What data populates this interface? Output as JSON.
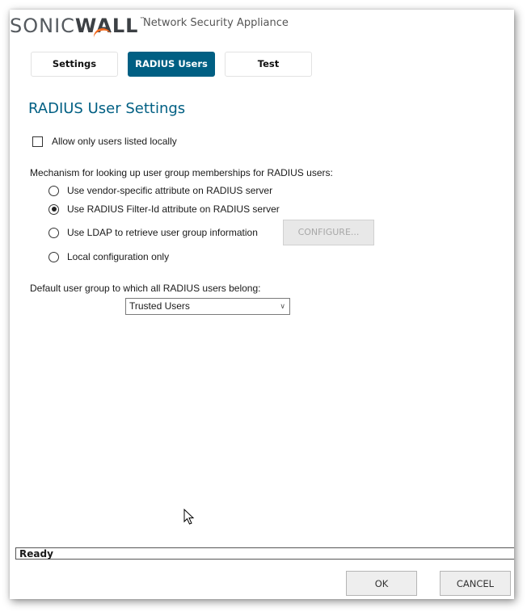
{
  "header": {
    "logo_sonic": "SONIC",
    "logo_wall": "WALL",
    "logo_tm": "™",
    "subtitle": "Network Security Appliance"
  },
  "tabs": [
    {
      "label": "Settings",
      "active": false
    },
    {
      "label": "RADIUS Users",
      "active": true
    },
    {
      "label": "Test",
      "active": false
    }
  ],
  "main": {
    "title": "RADIUS User Settings",
    "allow_local_only": {
      "label": "Allow only users listed locally",
      "checked": false
    },
    "mechanism_label": "Mechanism for looking up user group memberships for RADIUS users:",
    "mechanism_options": [
      {
        "label": "Use vendor-specific attribute on RADIUS server",
        "selected": false
      },
      {
        "label": "Use RADIUS Filter-Id attribute on RADIUS server",
        "selected": true
      },
      {
        "label": "Use LDAP to retrieve user group information",
        "selected": false
      },
      {
        "label": "Local configuration only",
        "selected": false
      }
    ],
    "configure_button": {
      "label": "CONFIGURE...",
      "enabled": false
    },
    "default_group_label": "Default user group to which all RADIUS users belong:",
    "default_group_value": "Trusted Users"
  },
  "status": {
    "text": "Ready"
  },
  "footer": {
    "ok_label": "OK",
    "cancel_label": "CANCEL"
  },
  "colors": {
    "accent": "#005f83",
    "logo_swoosh": "#f26b21"
  }
}
